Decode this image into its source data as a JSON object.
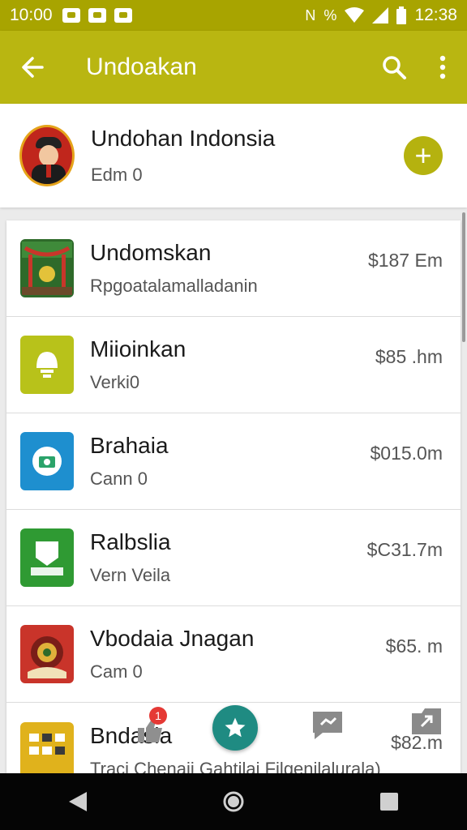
{
  "status_bar": {
    "time": "10:00",
    "clock": "12:38",
    "icons": [
      "notification-icon",
      "notification-icon",
      "notification-icon",
      "nfc-icon",
      "vibrate-icon",
      "wifi-icon",
      "signal-icon",
      "battery-icon"
    ]
  },
  "app_bar": {
    "title": "Undoakan",
    "color": "#b9b611",
    "icons": [
      "back-arrow-icon",
      "search-icon",
      "more-vert-icon"
    ]
  },
  "header": {
    "name": "Undohan Indonsia",
    "subtitle": "Edm 0",
    "add_icon": "+"
  },
  "list": {
    "items": [
      {
        "title": "Undomskan",
        "subtitle": "Rpgoatalamalladanin",
        "price": "$187 Em",
        "icon": "festival-icon",
        "icon_color": "#2e6a2a"
      },
      {
        "title": "Miioinkan",
        "subtitle": "Verki0",
        "price": "$85 .hm",
        "icon": "lightbulb-icon",
        "icon_color": "#b8c21a"
      },
      {
        "title": "Brahaia",
        "subtitle": "Cann 0",
        "price": "$015.0m",
        "icon": "camera-icon",
        "icon_color": "#1e8fcf"
      },
      {
        "title": "Ralbslia",
        "subtitle": "Vern Veila",
        "price": "$C31.7m",
        "icon": "chat-icon",
        "icon_color": "#2f9a33"
      },
      {
        "title": "Vbodaia Jnagan",
        "subtitle": "Cam 0",
        "price": "$65. m",
        "icon": "emblem-icon",
        "icon_color": "#c9342a"
      },
      {
        "title": "Bndasia",
        "subtitle": "Traci Chenaji Gahtilai Filgenilalurala)",
        "price": "$82.m",
        "icon": "grid-app-icon",
        "icon_color": "#e0b21c"
      }
    ]
  },
  "bottom_actions": {
    "badge_count": "1",
    "icons": [
      "thumbs-up-icon",
      "star-icon",
      "chat-bubble-icon",
      "share-icon"
    ]
  },
  "nav_bar": {
    "icons": [
      "back-triangle-icon",
      "home-circle-icon",
      "recents-square-icon"
    ]
  }
}
